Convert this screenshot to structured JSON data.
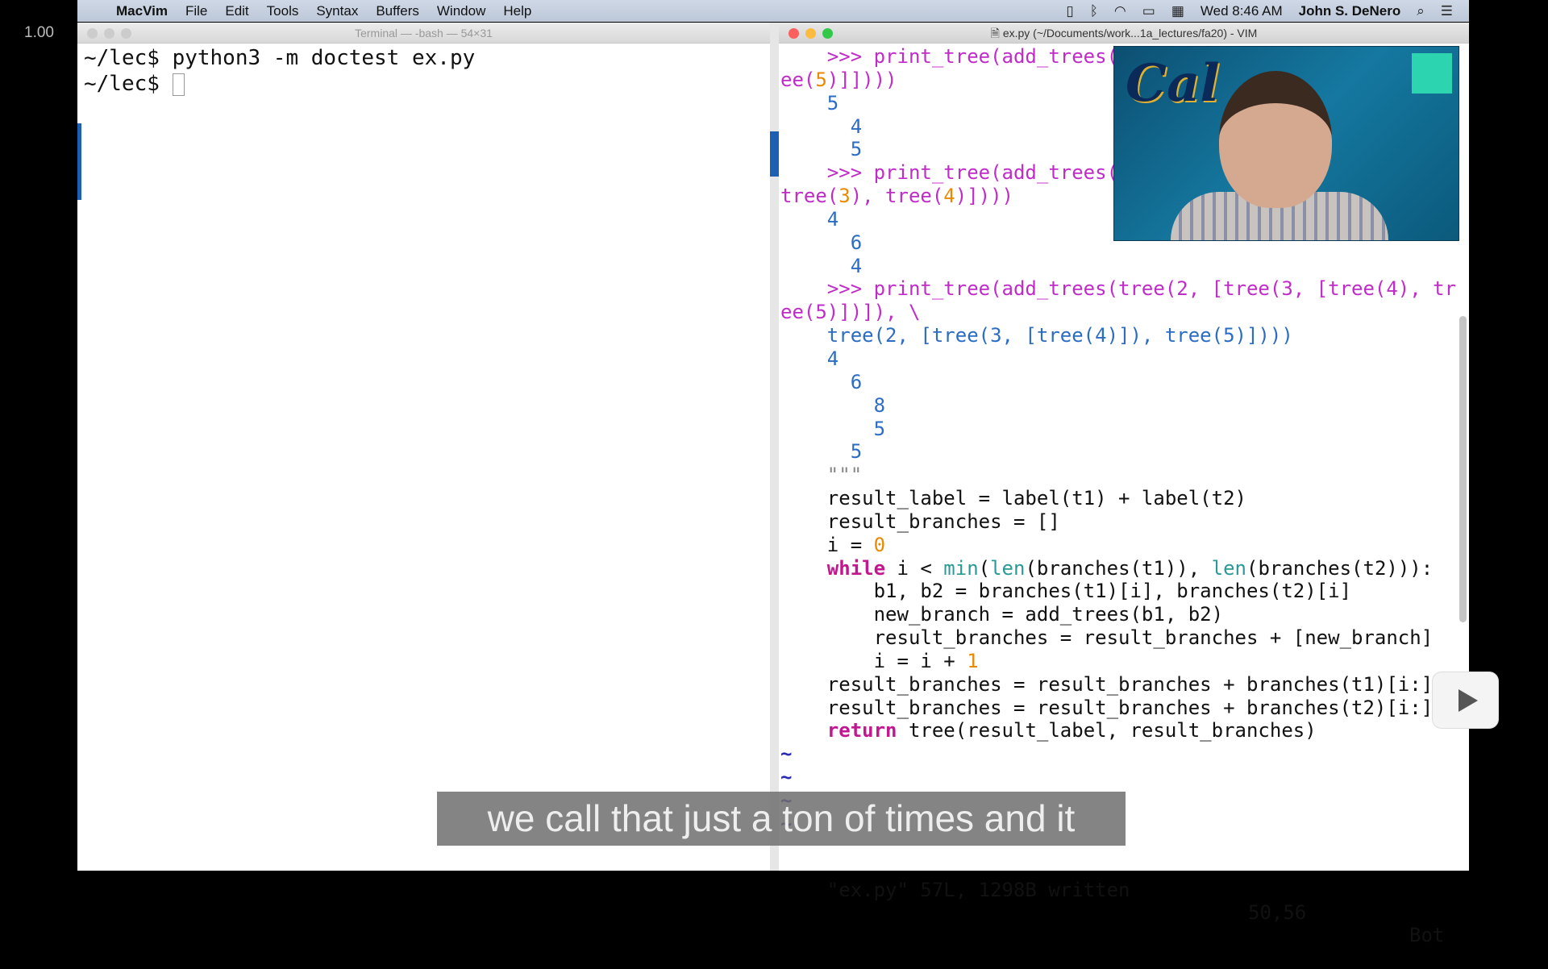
{
  "player": {
    "speed": "1.00",
    "subtitle": "we call that just a ton of times and it"
  },
  "menubar": {
    "app": "MacVim",
    "items": [
      "File",
      "Edit",
      "Tools",
      "Syntax",
      "Buffers",
      "Window",
      "Help"
    ],
    "clock": "Wed 8:46 AM",
    "user": "John S. DeNero"
  },
  "terminal": {
    "title": "Terminal — -bash — 54×31",
    "lines": [
      "~/lec$ python3 -m doctest ex.py",
      "~/lec$ "
    ]
  },
  "vim": {
    "title": "ex.py (~/Documents/work...1a_lectures/fa20) - VIM",
    "lines": [
      [
        [
          "prompt",
          "    >>> print_tree(add_trees("
        ]
      ],
      [
        [
          "prompt",
          "ee("
        ],
        [
          "num",
          "5"
        ],
        [
          "prompt",
          ")]])))"
        ]
      ],
      [
        [
          "out",
          "    5"
        ]
      ],
      [
        [
          "out",
          "      4"
        ]
      ],
      [
        [
          "out",
          "      5"
        ]
      ],
      [
        [
          "prompt",
          "    >>> print_tree(add_trees("
        ]
      ],
      [
        [
          "prompt",
          "tree("
        ],
        [
          "num",
          "3"
        ],
        [
          "prompt",
          "), tree("
        ],
        [
          "num",
          "4"
        ],
        [
          "prompt",
          ")])))"
        ]
      ],
      [
        [
          "out",
          "    4"
        ]
      ],
      [
        [
          "out",
          "      6"
        ]
      ],
      [
        [
          "out",
          "      4"
        ]
      ],
      [
        [
          "prompt",
          "    >>> print_tree(add_trees(tree(2, [tree(3, [tree(4), tr"
        ]
      ],
      [
        [
          "prompt",
          "ee(5)])]), \\"
        ]
      ],
      [
        [
          "out",
          "    tree(2, [tree(3, [tree(4)]), tree(5)])))"
        ]
      ],
      [
        [
          "out",
          "    4"
        ]
      ],
      [
        [
          "out",
          "      6"
        ]
      ],
      [
        [
          "out",
          "        8"
        ]
      ],
      [
        [
          "out",
          "        5"
        ]
      ],
      [
        [
          "out",
          "      5"
        ]
      ],
      [
        [
          "str",
          "    \"\"\""
        ]
      ],
      [
        [
          "",
          "    result_label = label(t1) + label(t2)"
        ]
      ],
      [
        [
          "",
          "    result_branches = []"
        ]
      ],
      [
        [
          "",
          "    i = "
        ],
        [
          "num",
          "0"
        ]
      ],
      [
        [
          "kw",
          "    while"
        ],
        [
          "",
          " i < "
        ],
        [
          "bi",
          "min"
        ],
        [
          "",
          "("
        ],
        [
          "bi",
          "len"
        ],
        [
          "",
          "(branches(t1)), "
        ],
        [
          "bi",
          "len"
        ],
        [
          "",
          "(branches(t2))):"
        ]
      ],
      [
        [
          "",
          "        b1, b2 = branches(t1)[i], branches(t2)[i]"
        ]
      ],
      [
        [
          "",
          "        new_branch = add_trees(b1, b2)"
        ]
      ],
      [
        [
          "",
          "        result_branches = result_branches + [new_branch]"
        ]
      ],
      [
        [
          "",
          "        i = i + "
        ],
        [
          "num",
          "1"
        ]
      ],
      [
        [
          "",
          "    result_branches = result_branches + branches(t1)[i:]"
        ]
      ],
      [
        [
          "",
          "    result_branches = result_branches + branches(t2)[i:]"
        ]
      ],
      [
        [
          "kw",
          "    return"
        ],
        [
          "",
          " tree(result_label, result_branches)"
        ]
      ],
      [
        [
          "tilde",
          "~"
        ]
      ],
      [
        [
          "tilde",
          "~"
        ]
      ],
      [
        [
          "tilde",
          "~"
        ]
      ],
      [
        [
          "tilde",
          "~"
        ]
      ]
    ],
    "status": {
      "message": "\"ex.py\" 57L, 1298B written",
      "position": "50,56",
      "scroll": "Bot"
    }
  },
  "webcam": {
    "logo": "Cal"
  }
}
